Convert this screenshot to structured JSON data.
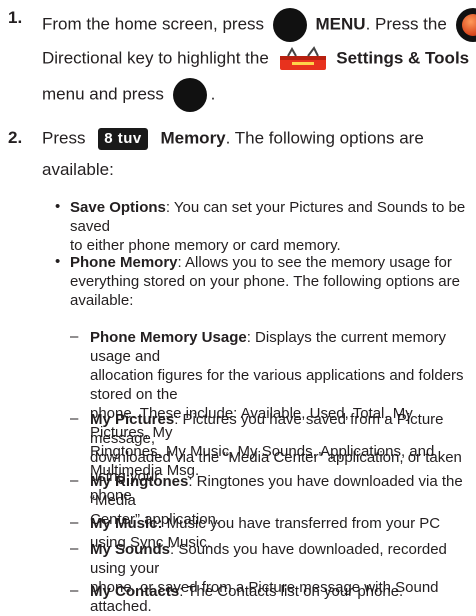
{
  "step1": {
    "num": "1.",
    "l1a": "From the home screen, press",
    "l1b": "MENU",
    "l1c": ". Press the",
    "l2a": "Directional key to highlight the",
    "l2b": "Settings & Tools",
    "l3a": "menu and press",
    "l3b": "."
  },
  "step2": {
    "num": "2.",
    "press": "Press",
    "key": "8 tuv",
    "memory": "Memory",
    "rest1": ". The following options are",
    "rest2": "available:"
  },
  "bullets": [
    {
      "title": "Save Options",
      "l1": ": You can set your Pictures and Sounds to be saved",
      "l2": "to either phone memory or card memory."
    },
    {
      "title": "Phone Memory",
      "l1": ": Allows you to see the memory usage for",
      "l2": "everything stored on your phone. The following options are",
      "l3": "available:"
    }
  ],
  "subitems": [
    {
      "title": "Phone Memory Usage",
      "l1": ": Displays the current memory usage and",
      "l2": "allocation figures for the various applications and folders stored on the",
      "l3": "phone. These include: Available, Used, Total, My Pictures, My",
      "l4": "Ringtones, My Music, My Sounds, Applications, and Multimedia Msg."
    },
    {
      "title": "My Pictures",
      "l1": ": Pictures you have saved from a Picture message,",
      "l2": "downloaded via the “Media Center” application, or taken using your",
      "l3": "phone."
    },
    {
      "title": "My Ringtones",
      "l1": ": Ringtones you have downloaded via the “Media",
      "l2": "Center” application."
    },
    {
      "title": "My Music:",
      "l1": " Music you have transferred from your PC using Sync Music."
    },
    {
      "title": "My Sounds",
      "l1": ": Sounds you have downloaded, recorded using your",
      "l2": "phone, or saved from a Picture message with Sound attached."
    },
    {
      "title": "My Contacts",
      "l1": ": The Contacts list on your phone."
    }
  ]
}
